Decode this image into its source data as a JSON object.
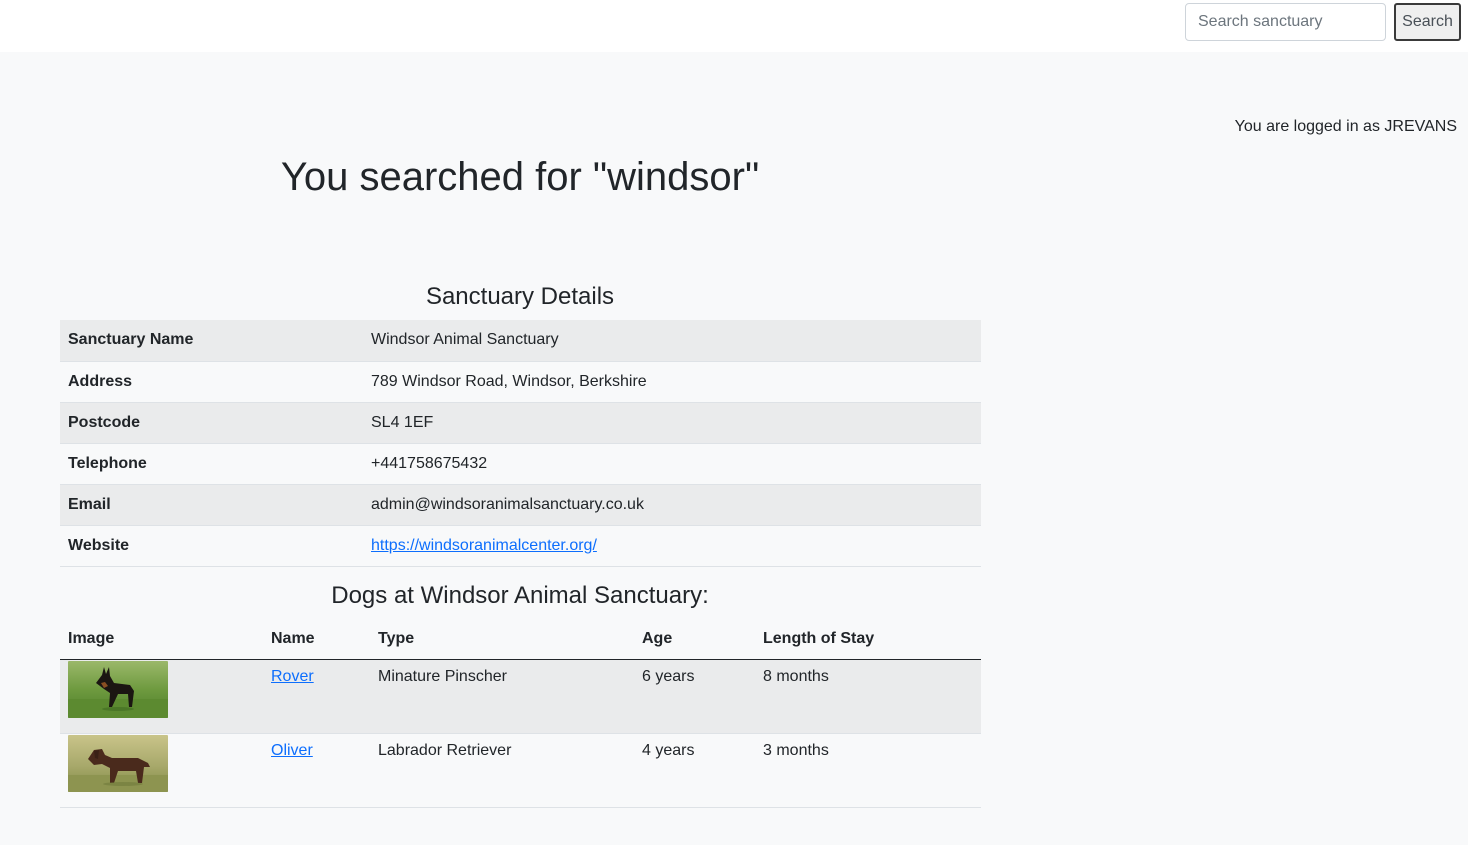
{
  "header": {
    "search_placeholder": "Search sanctuary",
    "search_button_label": "Search"
  },
  "login_status": "You are logged in as JREVANS",
  "page_title": "You searched for \"windsor\"",
  "details": {
    "title": "Sanctuary Details",
    "rows": [
      {
        "label": "Sanctuary Name",
        "value": "Windsor Animal Sanctuary"
      },
      {
        "label": "Address",
        "value": "789 Windsor Road, Windsor, Berkshire"
      },
      {
        "label": "Postcode",
        "value": "SL4 1EF"
      },
      {
        "label": "Telephone",
        "value": "+441758675432"
      },
      {
        "label": "Email",
        "value": "admin@windsoranimalsanctuary.co.uk"
      },
      {
        "label": "Website",
        "value": "https://windsoranimalcenter.org/"
      }
    ]
  },
  "dogs": {
    "title": "Dogs at Windsor Animal Sanctuary:",
    "columns": [
      "Image",
      "Name",
      "Type",
      "Age",
      "Length of Stay"
    ],
    "rows": [
      {
        "name": "Rover",
        "type": "Minature Pinscher",
        "age": "6 years",
        "stay": "8 months",
        "image": "miniature-pinscher-photo"
      },
      {
        "name": "Oliver",
        "type": "Labrador Retriever",
        "age": "4 years",
        "stay": "3 months",
        "image": "chocolate-labrador-photo"
      }
    ]
  },
  "colors": {
    "link": "#0d6efd",
    "stripe": "#eaebec",
    "background": "#f8f9fa"
  }
}
